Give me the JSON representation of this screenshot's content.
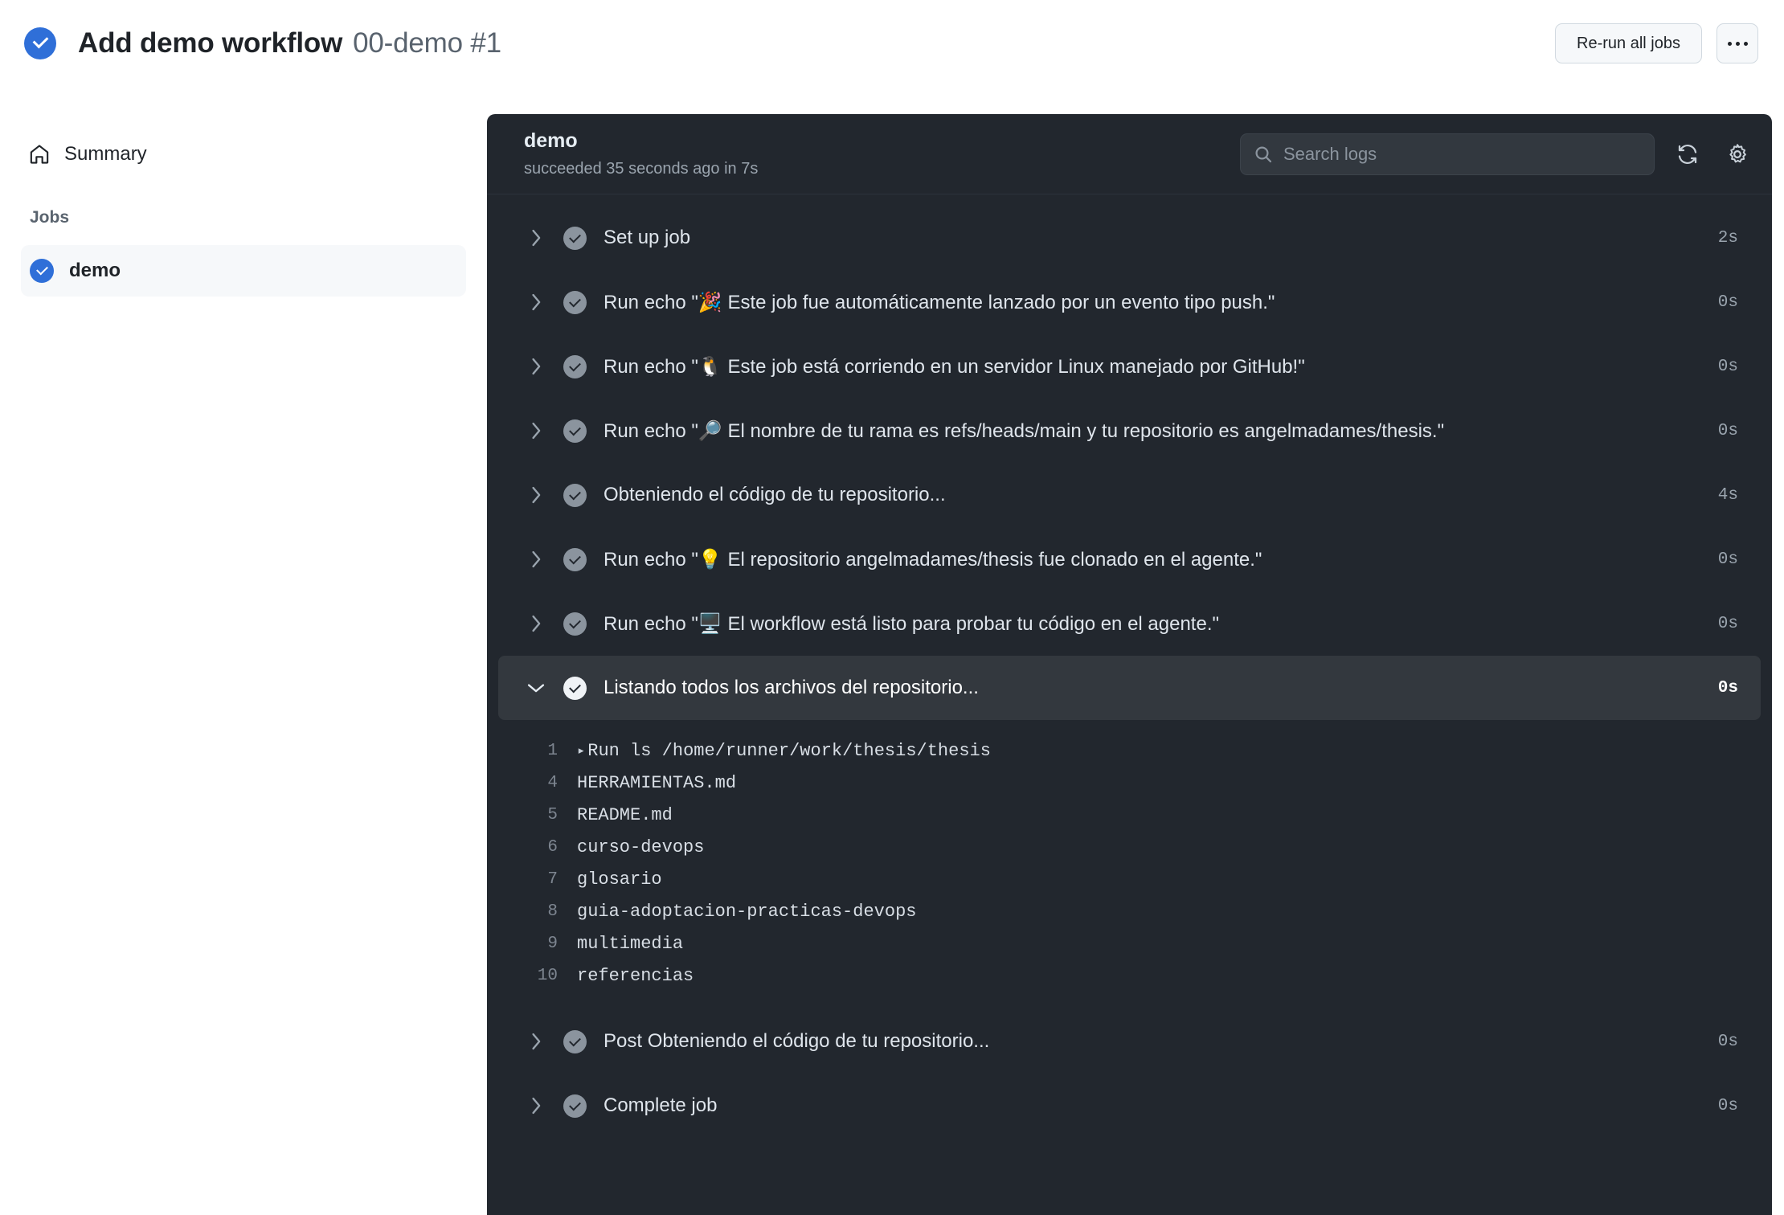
{
  "header": {
    "status_icon": "check-circle-blue",
    "title": "Add demo workflow",
    "subtitle": "00-demo #1",
    "rerun_label": "Re-run all jobs",
    "kebab_label": "…"
  },
  "sidebar": {
    "summary_label": "Summary",
    "jobs_heading": "Jobs",
    "jobs": [
      {
        "name": "demo",
        "status": "success"
      }
    ]
  },
  "log_panel": {
    "job_title": "demo",
    "job_status_line": "succeeded 35 seconds ago in 7s",
    "search_placeholder": "Search logs",
    "refresh_icon": "refresh-icon",
    "settings_icon": "gear-icon",
    "steps": [
      {
        "label": "Set up job",
        "duration": "2s",
        "expanded": false
      },
      {
        "label": "Run echo \"🎉 Este job fue automáticamente lanzado por un evento tipo push.\"",
        "duration": "0s",
        "expanded": false
      },
      {
        "label": "Run echo \"🐧 Este job está corriendo en un servidor Linux manejado por GitHub!\"",
        "duration": "0s",
        "expanded": false
      },
      {
        "label": "Run echo \"🔎 El nombre de tu rama es refs/heads/main y tu repositorio es angelmadames/thesis.\"",
        "duration": "0s",
        "expanded": false
      },
      {
        "label": "Obteniendo el código de tu repositorio...",
        "duration": "4s",
        "expanded": false
      },
      {
        "label": "Run echo \"💡 El repositorio angelmadames/thesis fue clonado en el agente.\"",
        "duration": "0s",
        "expanded": false
      },
      {
        "label": "Run echo \"🖥️ El workflow está listo para probar tu código en el agente.\"",
        "duration": "0s",
        "expanded": false
      },
      {
        "label": "Listando todos los archivos del repositorio...",
        "duration": "0s",
        "expanded": true
      },
      {
        "label": "Post Obteniendo el código de tu repositorio...",
        "duration": "0s",
        "expanded": false
      },
      {
        "label": "Complete job",
        "duration": "0s",
        "expanded": false
      }
    ],
    "log_lines": [
      {
        "num": "1",
        "text": "Run ls /home/runner/work/thesis/thesis",
        "arrow": true
      },
      {
        "num": "4",
        "text": "HERRAMIENTAS.md",
        "arrow": false
      },
      {
        "num": "5",
        "text": "README.md",
        "arrow": false
      },
      {
        "num": "6",
        "text": "curso-devops",
        "arrow": false
      },
      {
        "num": "7",
        "text": "glosario",
        "arrow": false
      },
      {
        "num": "8",
        "text": "guia-adoptacion-practicas-devops",
        "arrow": false
      },
      {
        "num": "9",
        "text": "multimedia",
        "arrow": false
      },
      {
        "num": "10",
        "text": "referencias",
        "arrow": false
      }
    ]
  },
  "colors": {
    "accent_blue": "#2f6fd8",
    "panel_bg": "#22272e",
    "panel_row_active": "#33383e",
    "sidebar_active": "#f6f8fa",
    "text_primary": "#1f2328",
    "text_muted": "#59636e"
  }
}
